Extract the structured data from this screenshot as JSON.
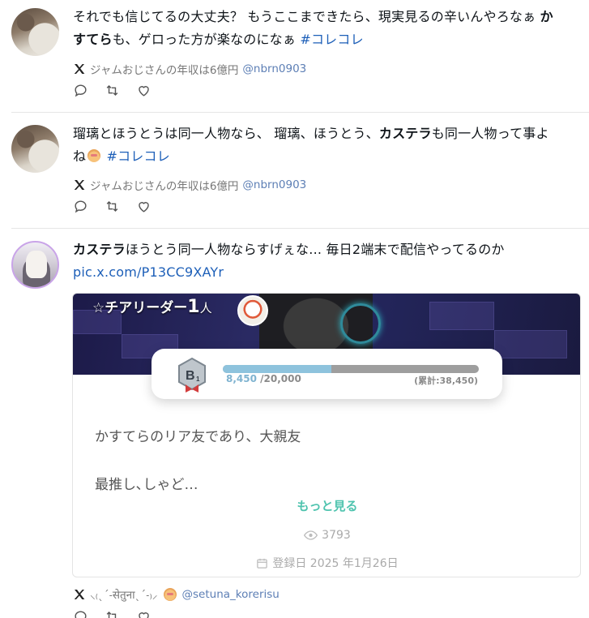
{
  "tweets": [
    {
      "text_parts": [
        "それでも信じてるの大丈夫？ もうここまできたら、現実見るの辛いんやろなぁ ",
        "か",
        "すてら",
        "も、ゲロった方が楽なのになぁ ",
        "#コレコレ"
      ],
      "source_name": "ジャムおじさんの年収は6億円",
      "source_handle": "@nbrn0903"
    },
    {
      "text_parts": [
        "瑠璃とほうとうは同一人物なら、 瑠璃、ほうとう、",
        "カステラ",
        "も同一人物って事よ",
        "ね",
        "#コレコレ"
      ],
      "source_name": "ジャムおじさんの年収は6億円",
      "source_handle": "@nbrn0903"
    },
    {
      "text_parts": [
        "カステラ",
        "ほうとう同一人物ならすげぇな... 毎日2端末で配信やってるのか",
        "pic.x.com/P13CC9XAYr"
      ],
      "source_name": "⸜₍ˎˊ˗सेतुनाˎˊ˗₎⸝",
      "source_handle": "@setuna_korerisu"
    }
  ],
  "card": {
    "cheer_prefix": "☆チアリーダー",
    "cheer_count": "1",
    "cheer_unit": "人",
    "rank": "B",
    "rank_sub": "1",
    "progress_current": "8,450",
    "progress_goal": "/20,000",
    "progress_fraction": 0.4225,
    "progress_cumulative": "(累計:38,450)",
    "bio_line1": "かすてらのリア友であり、大親友",
    "bio_line2": "最推し､しゃど…",
    "more_label": "もっと見る",
    "view_count": "3793",
    "registered": "登録日 2025 年1月26日"
  },
  "colors": {
    "hashtag": "#1d5fb8",
    "handle": "#5d7fb5",
    "more": "#4ec3ae",
    "bar_fill": "#8ec3dd"
  },
  "icons": [
    "x-logo-icon",
    "reply-icon",
    "retweet-icon",
    "like-icon",
    "eye-icon",
    "calendar-icon"
  ]
}
